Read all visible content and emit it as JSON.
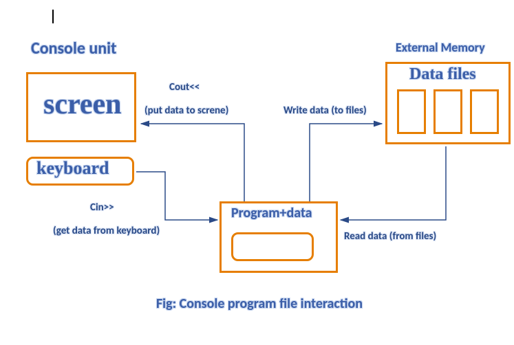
{
  "console_unit": "Console unit",
  "external_memory": "External Memory",
  "screen": "screen",
  "keyboard": "keyboard",
  "data_files": "Data files",
  "program_data": "Program+data",
  "cout": "Cout<<",
  "cout_sub": "(put data to screne)",
  "cin": "Cin>>",
  "cin_sub": "(get data from keyboard)",
  "write": "Write data (to files)",
  "read": "Read data (from  files)",
  "caption": "Fig: Console  program  file interaction"
}
